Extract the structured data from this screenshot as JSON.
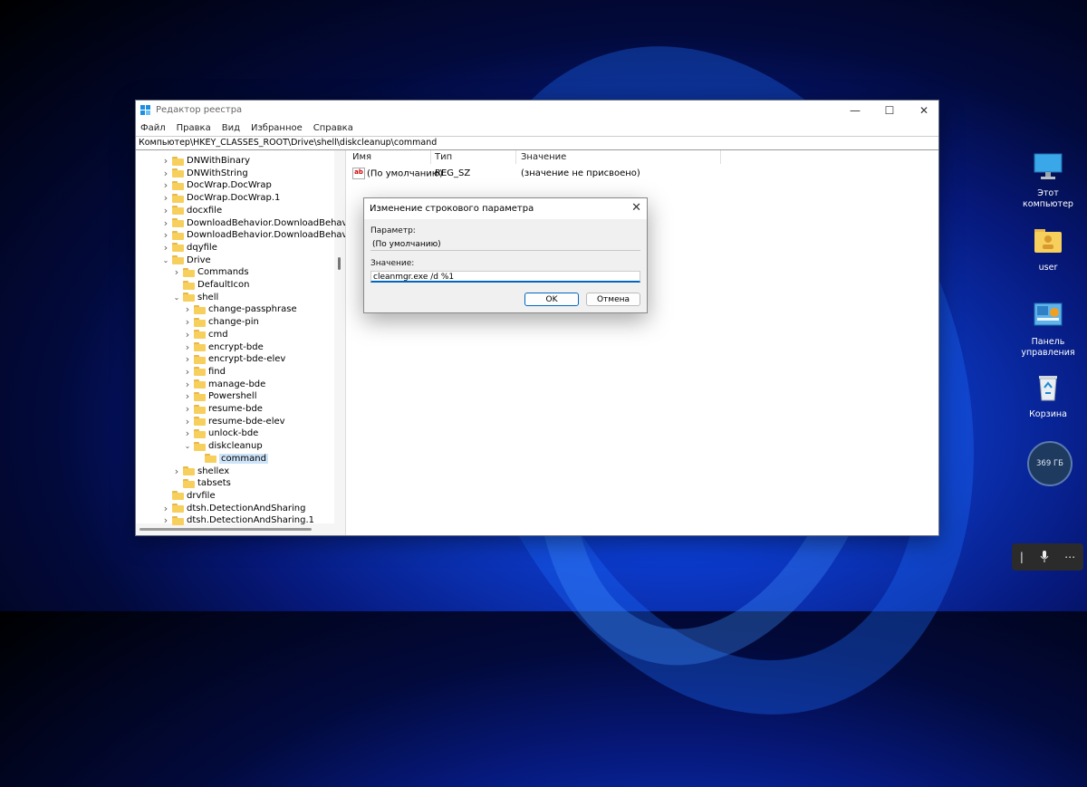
{
  "window": {
    "title": "Редактор реестра",
    "menu": [
      "Файл",
      "Правка",
      "Вид",
      "Избранное",
      "Справка"
    ],
    "address": "Компьютер\\HKEY_CLASSES_ROOT\\Drive\\shell\\diskcleanup\\command",
    "controls": {
      "minimize": "—",
      "maximize": "☐",
      "close": "✕"
    }
  },
  "tree": {
    "nodes": [
      {
        "label": "DNWithBinary",
        "expanded": false
      },
      {
        "label": "DNWithString",
        "expanded": false
      },
      {
        "label": "DocWrap.DocWrap",
        "expanded": false
      },
      {
        "label": "DocWrap.DocWrap.1",
        "expanded": false
      },
      {
        "label": "docxfile",
        "expanded": false
      },
      {
        "label": "DownloadBehavior.DownloadBehavior",
        "expanded": false
      },
      {
        "label": "DownloadBehavior.DownloadBehavior.",
        "expanded": false
      },
      {
        "label": "dqyfile",
        "expanded": false
      },
      {
        "label": "Drive",
        "expanded": true
      },
      {
        "label": "Commands",
        "expanded": false
      },
      {
        "label": "DefaultIcon",
        "expanded": null
      },
      {
        "label": "shell",
        "expanded": true
      },
      {
        "label": "change-passphrase",
        "expanded": false
      },
      {
        "label": "change-pin",
        "expanded": false
      },
      {
        "label": "cmd",
        "expanded": false
      },
      {
        "label": "encrypt-bde",
        "expanded": false
      },
      {
        "label": "encrypt-bde-elev",
        "expanded": false
      },
      {
        "label": "find",
        "expanded": false
      },
      {
        "label": "manage-bde",
        "expanded": false
      },
      {
        "label": "Powershell",
        "expanded": false
      },
      {
        "label": "resume-bde",
        "expanded": false
      },
      {
        "label": "resume-bde-elev",
        "expanded": false
      },
      {
        "label": "unlock-bde",
        "expanded": false
      },
      {
        "label": "diskcleanup",
        "expanded": true
      },
      {
        "label": "command",
        "expanded": null,
        "selected": true
      },
      {
        "label": "shellex",
        "expanded": false
      },
      {
        "label": "tabsets",
        "expanded": null
      },
      {
        "label": "drvfile",
        "expanded": null
      },
      {
        "label": "dtsh.DetectionAndSharing",
        "expanded": false
      },
      {
        "label": "dtsh.DetectionAndSharing.1",
        "expanded": false
      }
    ]
  },
  "values": {
    "columns": [
      "Имя",
      "Тип",
      "Значение"
    ],
    "rows": [
      {
        "icon": "ab",
        "name": "(По умолчанию)",
        "type": "REG_SZ",
        "data": "(значение не присвоено)"
      }
    ]
  },
  "dialog": {
    "title": "Изменение строкового параметра",
    "param_label": "Параметр:",
    "param_value": "(По умолчанию)",
    "value_label": "Значение:",
    "value_input": "cleanmgr.exe /d %1",
    "ok": "OK",
    "cancel": "Отмена",
    "close": "✕"
  },
  "desktop": {
    "icons": [
      {
        "label": "Этот компьютер",
        "icon": "monitor-icon"
      },
      {
        "label": "user",
        "icon": "user-folder-icon"
      },
      {
        "label": "Панель управления",
        "icon": "control-panel-icon"
      },
      {
        "label": "Корзина",
        "icon": "recycle-bin-icon"
      }
    ],
    "disk_widget": "369 ГБ"
  },
  "colors": {
    "accent": "#0067c0",
    "folder": "#f7cf5d",
    "selection": "#cde3f7"
  }
}
